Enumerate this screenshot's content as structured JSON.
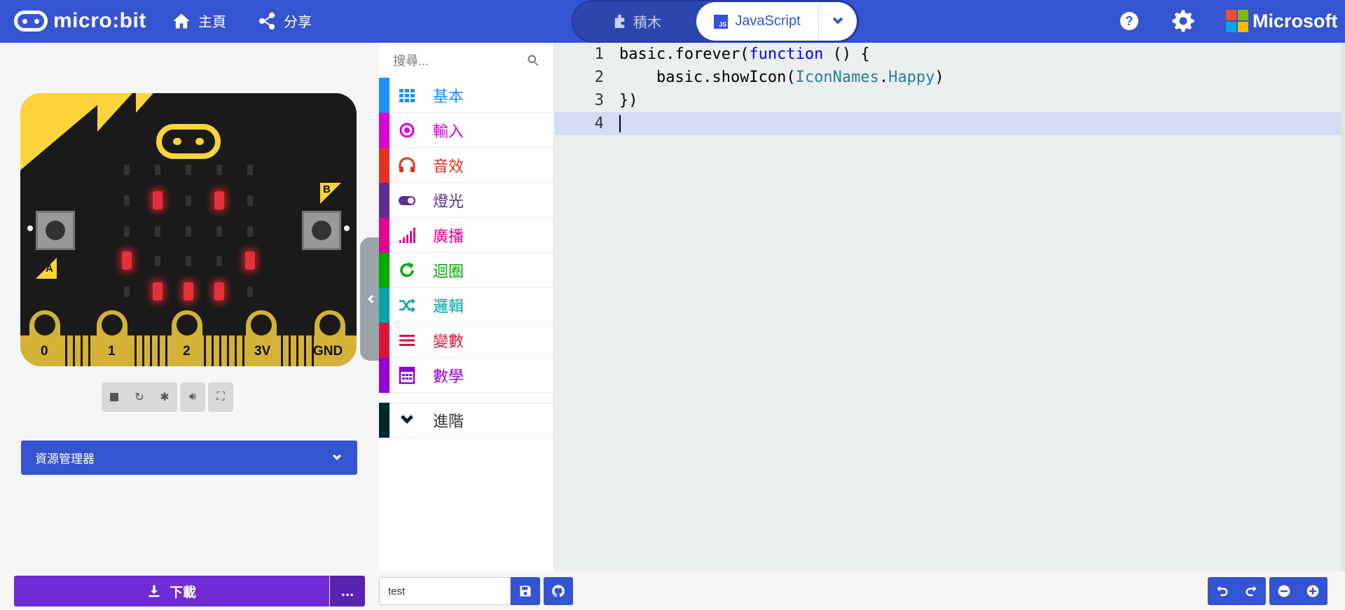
{
  "header": {
    "logo_text": "micro:bit",
    "home_label": "主頁",
    "share_label": "分享",
    "blocks_label": "積木",
    "javascript_label": "JavaScript",
    "js_badge": "JS",
    "brand": "Microsoft",
    "brand_colors": [
      "#f25022",
      "#7fba00",
      "#00a4ef",
      "#ffb900"
    ]
  },
  "simulator": {
    "button_a": "A",
    "button_b": "B",
    "pins": [
      "0",
      "1",
      "2",
      "3V",
      "GND"
    ],
    "led_matrix": [
      [
        0,
        0,
        0,
        0,
        0
      ],
      [
        0,
        1,
        0,
        1,
        0
      ],
      [
        0,
        0,
        0,
        0,
        0
      ],
      [
        1,
        0,
        0,
        0,
        1
      ],
      [
        0,
        1,
        1,
        1,
        0
      ]
    ],
    "controls": [
      "stop-icon",
      "restart-icon",
      "debug-icon",
      "mute-icon",
      "fullscreen-icon"
    ]
  },
  "explorer": {
    "label": "資源管理器"
  },
  "toolbox": {
    "search_placeholder": "搜尋...",
    "categories": [
      {
        "label": "基本",
        "color": "#1e90ff",
        "icon": "grid-icon"
      },
      {
        "label": "輸入",
        "color": "#d400d4",
        "icon": "target-icon"
      },
      {
        "label": "音效",
        "color": "#e63022",
        "icon": "headphones-icon"
      },
      {
        "label": "燈光",
        "color": "#5c2d91",
        "icon": "toggle-icon"
      },
      {
        "label": "廣播",
        "color": "#e3008c",
        "icon": "signal-icon"
      },
      {
        "label": "迴圈",
        "color": "#00aa00",
        "icon": "refresh-icon"
      },
      {
        "label": "邏輯",
        "color": "#00a4a6",
        "icon": "shuffle-icon"
      },
      {
        "label": "變數",
        "color": "#dc143c",
        "icon": "lines-icon"
      },
      {
        "label": "數學",
        "color": "#9400d3",
        "icon": "calculator-icon"
      },
      {
        "label": "進階",
        "color": "#00272b",
        "icon": "chevron-down-icon"
      }
    ]
  },
  "editor": {
    "lines": [
      {
        "num": "1",
        "text": "basic.forever(function () {"
      },
      {
        "num": "2",
        "text": "    basic.showIcon(IconNames.Happy)"
      },
      {
        "num": "3",
        "text": "})"
      },
      {
        "num": "4",
        "text": ""
      }
    ]
  },
  "bottombar": {
    "download_label": "下載",
    "more_label": "...",
    "project_name": "test"
  }
}
